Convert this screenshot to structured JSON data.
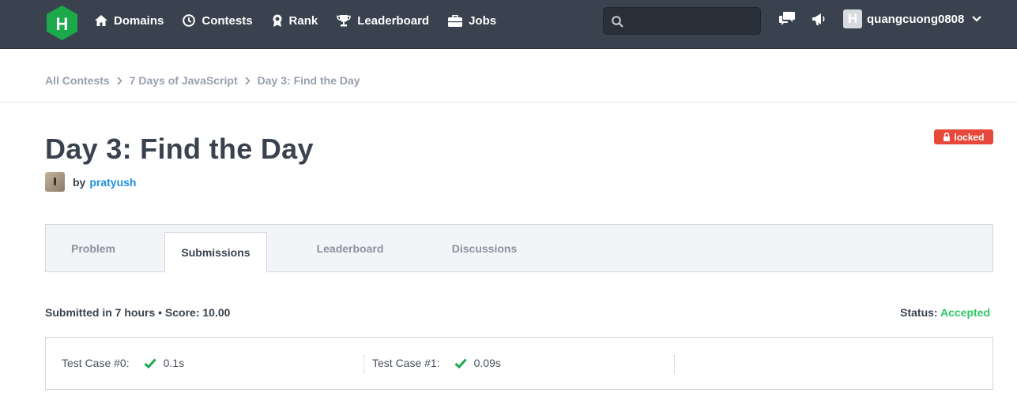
{
  "brand": {
    "logo_letter": "H",
    "logo_color": "#1ba94c"
  },
  "nav": {
    "items": [
      {
        "label": "Domains",
        "icon": "home-icon"
      },
      {
        "label": "Contests",
        "icon": "clock-icon"
      },
      {
        "label": "Rank",
        "icon": "medal-icon"
      },
      {
        "label": "Leaderboard",
        "icon": "trophy-icon"
      },
      {
        "label": "Jobs",
        "icon": "briefcase-icon"
      }
    ],
    "search_placeholder": "",
    "username": "quangcuong0808",
    "user_avatar_letter": "H"
  },
  "breadcrumb": [
    "All Contests",
    "7 Days of JavaScript",
    "Day 3: Find the Day"
  ],
  "challenge": {
    "title": "Day 3: Find the Day",
    "by_label": "by",
    "author": "pratyush",
    "locked_label": "locked"
  },
  "tabs": [
    {
      "label": "Problem",
      "active": false
    },
    {
      "label": "Submissions",
      "active": true
    },
    {
      "label": "Leaderboard",
      "active": false
    },
    {
      "label": "Discussions",
      "active": false
    }
  ],
  "submission": {
    "summary": "Submitted in 7 hours • Score: 10.00",
    "status_label": "Status:",
    "status_value": "Accepted"
  },
  "test_cases": [
    {
      "label": "Test Case #0:",
      "time": "0.1s",
      "passed": true
    },
    {
      "label": "Test Case #1:",
      "time": "0.09s",
      "passed": true
    }
  ],
  "colors": {
    "nav_bg": "#39424e",
    "accent_green": "#2ec866",
    "locked_red": "#e8483a",
    "link_blue": "#1f8fe0"
  }
}
